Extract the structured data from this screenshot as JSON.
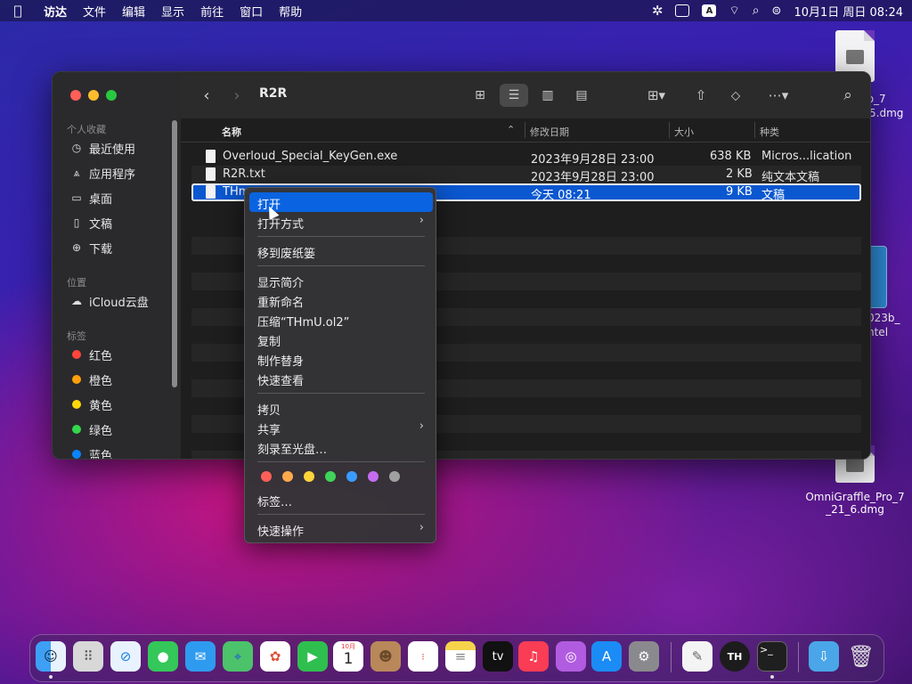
{
  "menubar": {
    "items": [
      "访达",
      "文件",
      "编辑",
      "显示",
      "前往",
      "窗口",
      "帮助"
    ],
    "clock": "10月1日 周日 08:24",
    "input_method": "A"
  },
  "desktop": {
    "icon1_label": "_Pro_7\n5.dmg",
    "icon1_line1": "_Pro_7",
    "icon1_line2": "5.dmg",
    "icon2_line1": "023b_",
    "icon2_line2": "ntel",
    "icon3_line1": "OmniGraffle_Pro_7",
    "icon3_line2": "_21_6.dmg"
  },
  "finder": {
    "title": "R2R",
    "sidebar": {
      "favorites_header": "个人收藏",
      "favorites": [
        "最近使用",
        "应用程序",
        "桌面",
        "文稿",
        "下载"
      ],
      "locations_header": "位置",
      "locations": [
        "iCloud云盘"
      ],
      "tags_header": "标签",
      "tags": [
        {
          "label": "红色",
          "color": "#ff453a"
        },
        {
          "label": "橙色",
          "color": "#ff9f0a"
        },
        {
          "label": "黄色",
          "color": "#ffd60a"
        },
        {
          "label": "绿色",
          "color": "#32d74b"
        },
        {
          "label": "蓝色",
          "color": "#0a84ff"
        }
      ]
    },
    "columns": {
      "name": "名称",
      "date": "修改日期",
      "size": "大小",
      "kind": "种类"
    },
    "files": [
      {
        "name": "Overloud_Special_KeyGen.exe",
        "date": "2023年9月28日 23:00",
        "size": "638 KB",
        "kind": "Micros...lication"
      },
      {
        "name": "R2R.txt",
        "date": "2023年9月28日 23:00",
        "size": "2 KB",
        "kind": "纯文本文稿"
      },
      {
        "name": "THm",
        "date": "今天 08:21",
        "size": "9 KB",
        "kind": "文稿"
      }
    ]
  },
  "context_menu": {
    "open": "打开",
    "open_with": "打开方式",
    "trash": "移到废纸篓",
    "get_info": "显示简介",
    "rename": "重新命名",
    "compress": "压缩“THmU.ol2”",
    "duplicate": "复制",
    "alias": "制作替身",
    "quick_look": "快速查看",
    "copy": "拷贝",
    "share": "共享",
    "burn": "刻录至光盘…",
    "tags": "标签…",
    "quick_actions": "快速操作",
    "tag_colors": [
      "#ff5f57",
      "#ffa94d",
      "#ffd43b",
      "#40d35a",
      "#3a9bff",
      "#c56cf0",
      "#a0a0a0"
    ]
  },
  "dock": {
    "calendar_month": "10月",
    "calendar_day": "1",
    "tv_label": "tv"
  }
}
